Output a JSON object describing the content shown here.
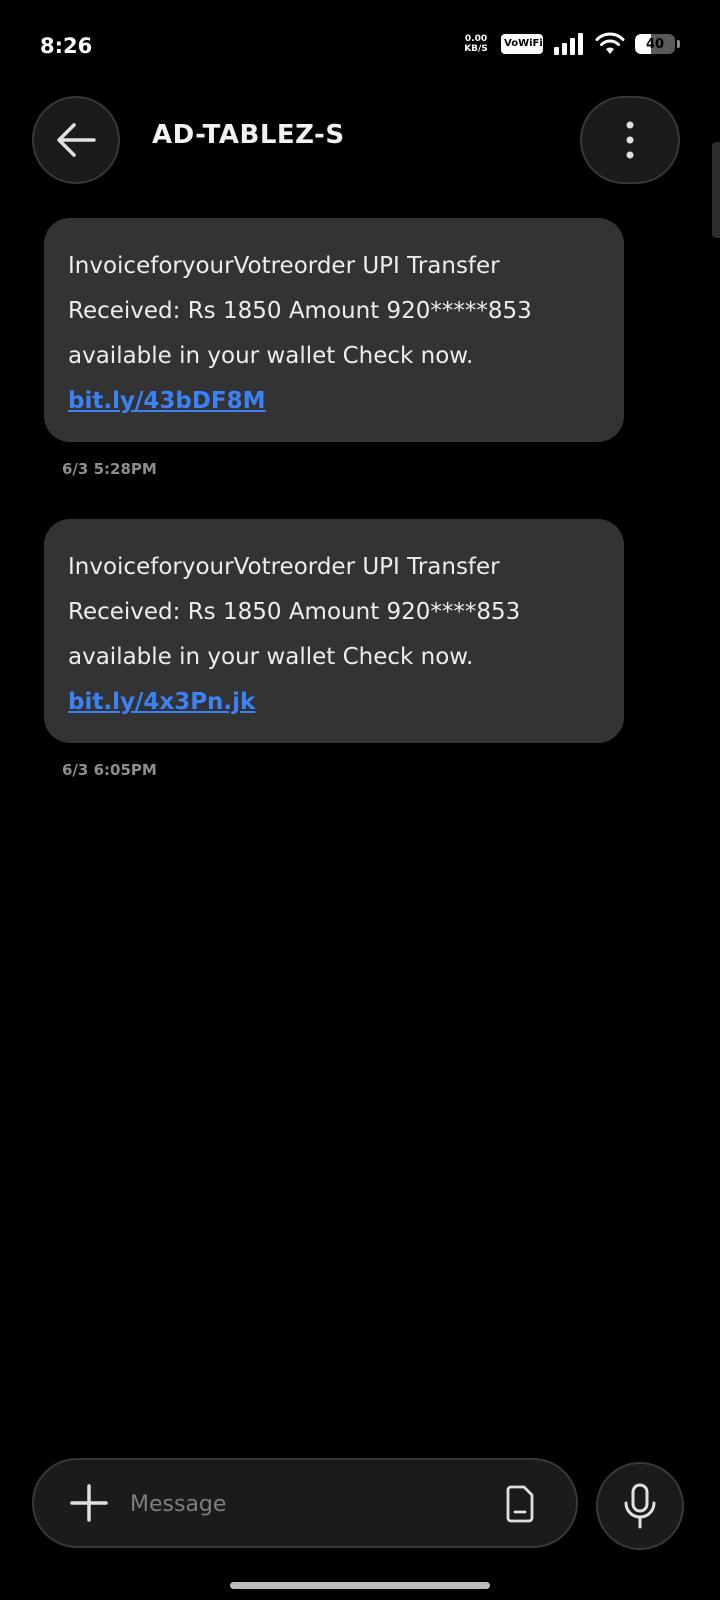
{
  "status_bar": {
    "time": "8:26",
    "net_speed_value": "0.00",
    "net_speed_unit": "KB/S",
    "vowifi_label": "VoWiFi",
    "battery_level": "40",
    "battery_fraction": 0.4
  },
  "header": {
    "contact_name": "AD-TABLEZ-S"
  },
  "messages": [
    {
      "text": "InvoiceforyourVotreorder UPI Transfer Received: Rs 1850 Amount 920*****853 available in your wallet Check now. ",
      "link": "bit.ly/43bDF8M",
      "timestamp": "6/3 5:28PM"
    },
    {
      "text": "InvoiceforyourVotreorder UPI Transfer Received: Rs 1850 Amount 920****853 available in your wallet Check now. ",
      "link": "bit.ly/4x3Pn.jk",
      "timestamp": "6/3 6:05PM"
    }
  ],
  "composer": {
    "placeholder": "Message"
  },
  "colors": {
    "background": "#000000",
    "bubble": "#333333",
    "link": "#3b82f6",
    "timestamp": "#8e8e8e"
  }
}
